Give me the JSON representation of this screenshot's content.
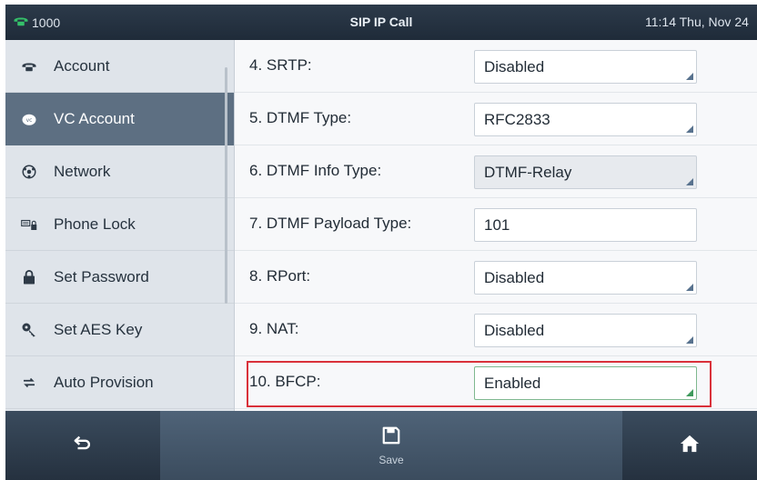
{
  "status_bar": {
    "account": "1000",
    "title": "SIP IP Call",
    "clock": "11:14 Thu, Nov 24"
  },
  "sidebar": {
    "items": [
      {
        "label": "Account",
        "icon": "phone-icon",
        "active": false
      },
      {
        "label": "VC Account",
        "icon": "vc-account-icon",
        "active": true
      },
      {
        "label": "Network",
        "icon": "network-icon",
        "active": false
      },
      {
        "label": "Phone Lock",
        "icon": "phone-lock-icon",
        "active": false
      },
      {
        "label": "Set Password",
        "icon": "lock-icon",
        "active": false
      },
      {
        "label": "Set AES Key",
        "icon": "key-icon",
        "active": false
      },
      {
        "label": "Auto Provision",
        "icon": "refresh-arrows-icon",
        "active": false
      }
    ]
  },
  "settings": {
    "rows": [
      {
        "label": "4. SRTP:",
        "value": "Disabled",
        "readonly": false
      },
      {
        "label": "5. DTMF Type:",
        "value": "RFC2833",
        "readonly": false
      },
      {
        "label": "6. DTMF Info Type:",
        "value": "DTMF-Relay",
        "readonly": true
      },
      {
        "label": "7. DTMF Payload Type:",
        "value": "101",
        "readonly": false
      },
      {
        "label": "8. RPort:",
        "value": "Disabled",
        "readonly": false
      },
      {
        "label": "9. NAT:",
        "value": "Disabled",
        "readonly": false
      },
      {
        "label": "10. BFCP:",
        "value": "Enabled",
        "readonly": false,
        "highlighted": true
      }
    ]
  },
  "softkeys": {
    "back_icon": "back-arrow-icon",
    "save_label": "Save",
    "save_icon": "save-icon",
    "home_icon": "home-icon"
  },
  "colors": {
    "highlight_border": "#d9313a",
    "active_sidebar": "#5d6f82",
    "status_bar": "#2c3a4a"
  }
}
